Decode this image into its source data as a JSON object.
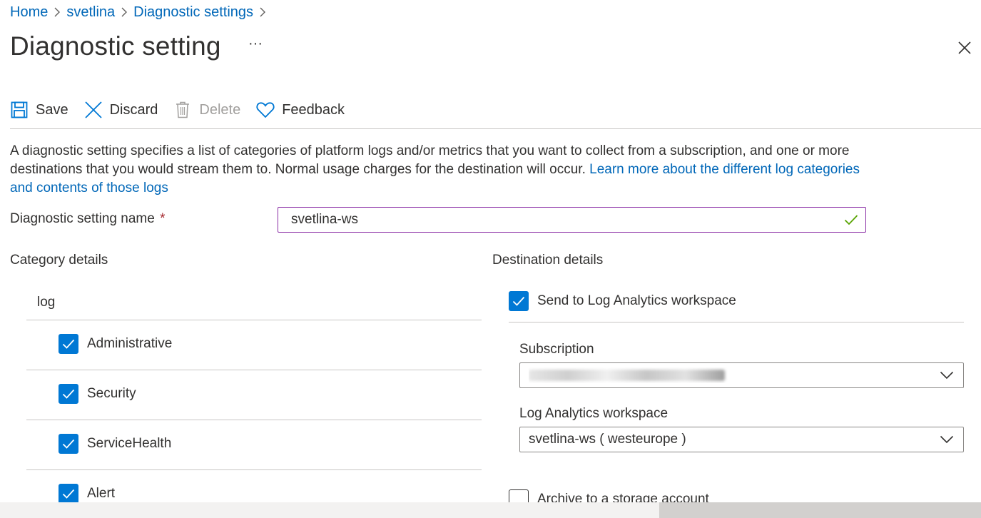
{
  "breadcrumb": [
    {
      "label": "Home"
    },
    {
      "label": "svetlina"
    },
    {
      "label": "Diagnostic settings"
    }
  ],
  "header": {
    "title": "Diagnostic setting",
    "more_label": "···"
  },
  "toolbar": {
    "save_label": "Save",
    "discard_label": "Discard",
    "delete_label": "Delete",
    "feedback_label": "Feedback"
  },
  "description": {
    "text": "A diagnostic setting specifies a list of categories of platform logs and/or metrics that you want to collect from a subscription, and one or more destinations that you would stream them to. Normal usage charges for the destination will occur. ",
    "link": "Learn more about the different log categories and contents of those logs"
  },
  "form": {
    "name_label": "Diagnostic setting name",
    "required_mark": "*",
    "name_value": "svetlina-ws"
  },
  "category_details": {
    "heading": "Category details",
    "group_label": "log",
    "items": [
      {
        "label": "Administrative",
        "checked": true
      },
      {
        "label": "Security",
        "checked": true
      },
      {
        "label": "ServiceHealth",
        "checked": true
      },
      {
        "label": "Alert",
        "checked": true
      }
    ]
  },
  "destination_details": {
    "heading": "Destination details",
    "send_to_law": {
      "label": "Send to Log Analytics workspace",
      "checked": true
    },
    "subscription_label": "Subscription",
    "workspace_label": "Log Analytics workspace",
    "workspace_value": "svetlina-ws ( westeurope )",
    "archive": {
      "label": "Archive to a storage account",
      "checked": false
    }
  },
  "colors": {
    "accent": "#0078d4",
    "link": "#0067b8",
    "input_focus_border": "#8a2da5",
    "valid_check": "#57a300",
    "required": "#a4262c"
  }
}
